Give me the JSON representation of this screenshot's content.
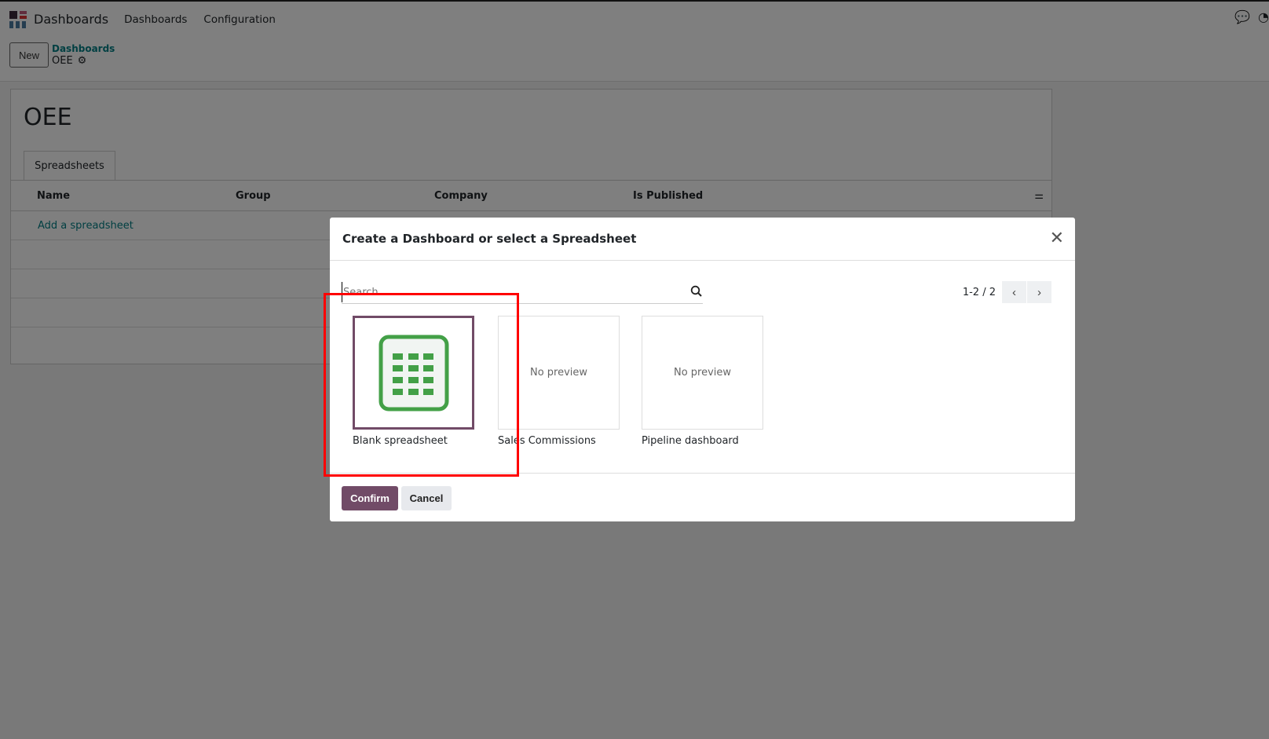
{
  "navbar": {
    "app_name": "Dashboards",
    "menu": [
      "Dashboards",
      "Configuration"
    ]
  },
  "control_panel": {
    "new_label": "New",
    "breadcrumb_parent": "Dashboards",
    "breadcrumb_current": "OEE"
  },
  "form": {
    "title": "OEE",
    "tab": "Spreadsheets",
    "columns": [
      "Name",
      "Group",
      "Company",
      "Is Published"
    ],
    "add_link": "Add a spreadsheet"
  },
  "dialog": {
    "title": "Create a Dashboard or select a Spreadsheet",
    "search_placeholder": "Search...",
    "pager": "1-2 / 2",
    "cards": [
      {
        "label": "Blank spreadsheet",
        "preview": ""
      },
      {
        "label": "Sales Commissions",
        "preview": "No preview"
      },
      {
        "label": "Pipeline dashboard",
        "preview": "No preview"
      }
    ],
    "confirm": "Confirm",
    "cancel": "Cancel"
  },
  "colors": {
    "primary": "#714b67",
    "spreadsheet_green": "#43a047",
    "annotation": "#ff0000"
  }
}
